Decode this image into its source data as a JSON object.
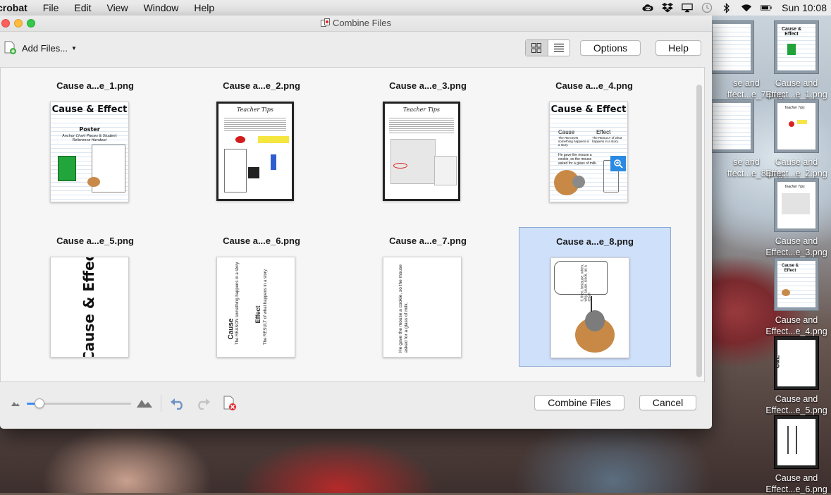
{
  "menubar": {
    "app": "crobat",
    "items": [
      "File",
      "Edit",
      "View",
      "Window",
      "Help"
    ],
    "clock": "Sun 10:08"
  },
  "desktop": {
    "icons": [
      {
        "line1": "se and",
        "line2": "ffect...e_7.png"
      },
      {
        "line1": "Cause and",
        "line2": "Effect...e_1.png"
      },
      {
        "line1": "se and",
        "line2": "ffect...e_8.png"
      },
      {
        "line1": "Cause and",
        "line2": "Effect...e_2.png"
      },
      {
        "line1": "Cause and",
        "line2": "Effect...e_3.png"
      },
      {
        "line1": "Cause and",
        "line2": "Effect...e_4.png"
      },
      {
        "line1": "Cause and",
        "line2": "Effect...e_5.png"
      },
      {
        "line1": "Cause and",
        "line2": "Effect...e_6.png"
      }
    ]
  },
  "dialog": {
    "title": "Combine Files",
    "add_files": "Add Files...",
    "options": "Options",
    "help": "Help",
    "combine": "Combine Files",
    "cancel": "Cancel",
    "selected_index": 7,
    "files": [
      {
        "name": "Cause a...e_1.png"
      },
      {
        "name": "Cause a...e_2.png"
      },
      {
        "name": "Cause a...e_3.png"
      },
      {
        "name": "Cause a...e_4.png"
      },
      {
        "name": "Cause a...e_5.png"
      },
      {
        "name": "Cause a...e_6.png"
      },
      {
        "name": "Cause a...e_7.png"
      },
      {
        "name": "Cause a...e_8.png"
      }
    ],
    "thumb_text": {
      "t1_title": "Cause & Effect",
      "t1_sub": "Poster",
      "t1_sub2": "Anchor Chart Pieces & Student Reference Handout",
      "t2_title": "Teacher Tips",
      "t3_title": "Teacher Tips",
      "t4_title": "Cause & Effect",
      "t4_cause": "Cause",
      "t4_effect": "Effect",
      "t4_cause_desc": "The REASON something happens in a story.",
      "t4_effect_desc": "The RESULT of what happens in a story.",
      "t4_sentence": "He gave the mouse a cookie, so the mouse asked for a glass of milk.",
      "t5_text": "Cause & Effect",
      "t6_cause": "Cause",
      "t6_cause_desc": "The REASON something happens in a story.",
      "t6_effect": "Effect",
      "t6_effect_desc": "The RESULT of what happens in a story.",
      "t7_text": "He gave the mouse a cookie, so the mouse asked for a glass of milk.",
      "t8_words": "if, then, because, when, why, cause, since, as a result"
    },
    "zoom_level": 0.12
  }
}
